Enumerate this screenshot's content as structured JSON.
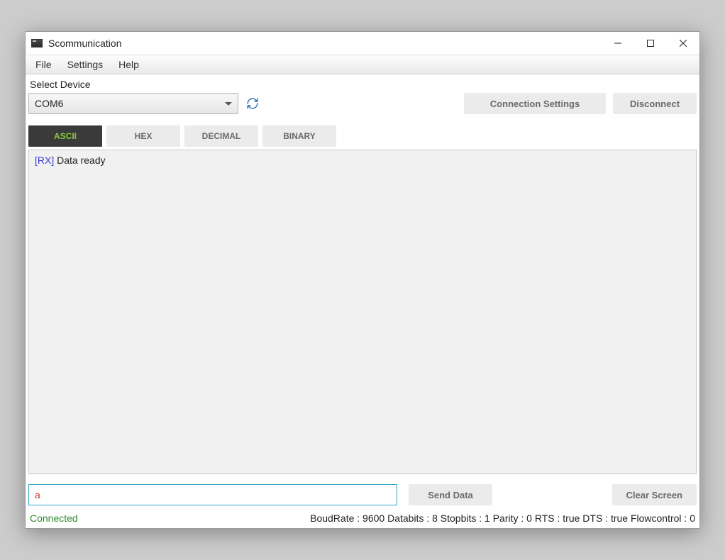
{
  "window": {
    "title": "Scommunication"
  },
  "menu": {
    "file": "File",
    "settings": "Settings",
    "help": "Help"
  },
  "device": {
    "label": "Select Device",
    "selected": "COM6"
  },
  "buttons": {
    "connection_settings": "Connection Settings",
    "disconnect": "Disconnect",
    "send_data": "Send Data",
    "clear_screen": "Clear Screen"
  },
  "tabs": {
    "ascii": "ASCII",
    "hex": "HEX",
    "decimal": "DECIMAL",
    "binary": "BINARY"
  },
  "terminal": {
    "rx_tag": "[RX]",
    "line1": "Data ready"
  },
  "input": {
    "value": "a"
  },
  "status": {
    "connected": "Connected",
    "detail": "BoudRate : 9600 Databits : 8 Stopbits : 1 Parity : 0 RTS : true DTS : true Flowcontrol : 0"
  }
}
